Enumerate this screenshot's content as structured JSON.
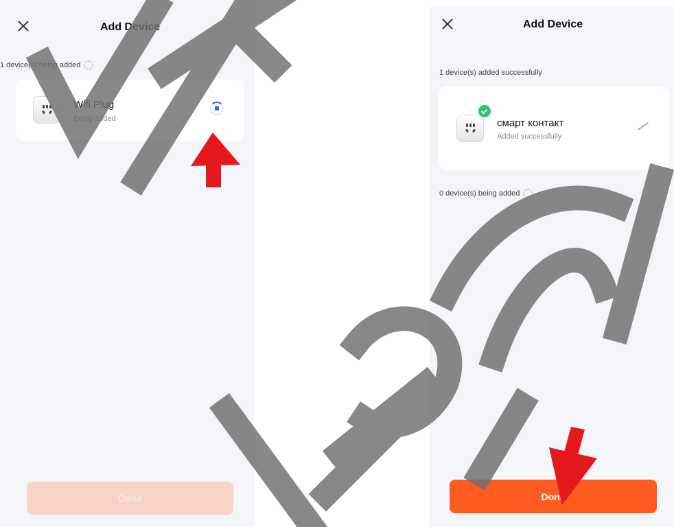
{
  "left": {
    "title": "Add Device",
    "adding_label": "1 device(s) being added",
    "device": {
      "name": "Wifi Plug",
      "status": "Being added"
    },
    "done_label": "Done"
  },
  "right": {
    "title": "Add Device",
    "success_label": "1 device(s) added successfully",
    "device": {
      "name": "смарт контакт",
      "status": "Added successfully"
    },
    "adding_label": "0 device(s) being added",
    "done_label": "Done"
  },
  "colors": {
    "accent": "#ff5a1f",
    "accent_disabled": "#f8d4c8",
    "progress": "#2f6bf0",
    "success": "#2cc46d",
    "arrow": "#e5181d"
  },
  "icons": [
    "close-icon",
    "plug-icon",
    "progress-icon",
    "check-icon",
    "edit-icon",
    "spinner-icon",
    "arrow-icon"
  ]
}
